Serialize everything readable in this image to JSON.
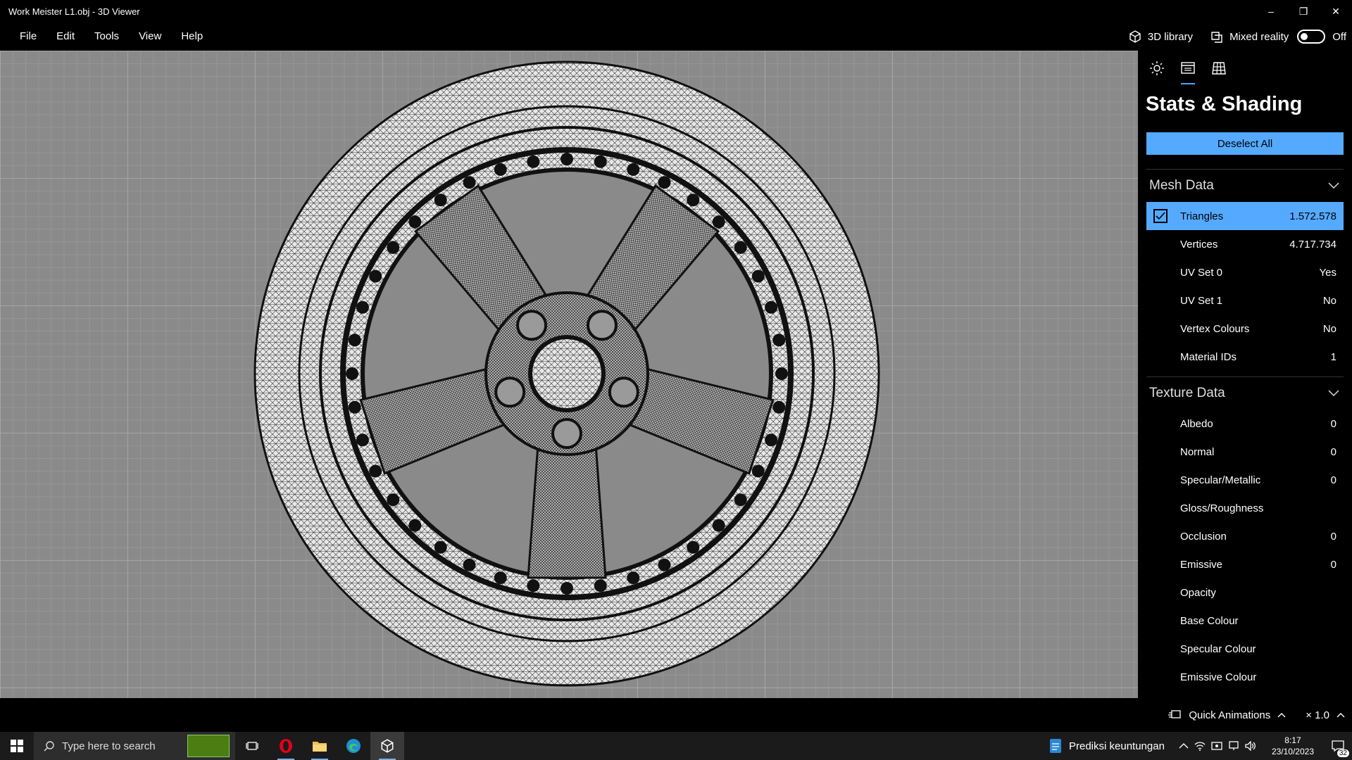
{
  "window": {
    "title": "Work Meister L1.obj - 3D Viewer",
    "minimize": "–",
    "restore": "❐",
    "close": "✕"
  },
  "menu": [
    "File",
    "Edit",
    "Tools",
    "View",
    "Help"
  ],
  "toolbar": {
    "library_label": "3D library",
    "mixed_reality_label": "Mixed reality",
    "mixed_reality_state": "Off"
  },
  "panel": {
    "title": "Stats & Shading",
    "deselect_label": "Deselect All",
    "mesh_section": "Mesh Data",
    "mesh_rows": [
      {
        "label": "Triangles",
        "value": "1.572.578"
      },
      {
        "label": "Vertices",
        "value": "4.717.734"
      },
      {
        "label": "UV Set 0",
        "value": "Yes"
      },
      {
        "label": "UV Set 1",
        "value": "No"
      },
      {
        "label": "Vertex Colours",
        "value": "No"
      },
      {
        "label": "Material IDs",
        "value": "1"
      }
    ],
    "texture_section": "Texture Data",
    "texture_rows": [
      {
        "label": "Albedo",
        "value": "0"
      },
      {
        "label": "Normal",
        "value": "0"
      },
      {
        "label": "Specular/Metallic",
        "value": "0"
      },
      {
        "label": "Gloss/Roughness",
        "value": ""
      },
      {
        "label": "Occlusion",
        "value": "0"
      },
      {
        "label": "Emissive",
        "value": "0"
      },
      {
        "label": "Opacity",
        "value": ""
      },
      {
        "label": "Base Colour",
        "value": ""
      },
      {
        "label": "Specular Colour",
        "value": ""
      },
      {
        "label": "Emissive Colour",
        "value": ""
      }
    ]
  },
  "bottom": {
    "quick_animations": "Quick Animations",
    "speed": "× 1.0"
  },
  "taskbar": {
    "search_placeholder": "Type here to search",
    "weather_text": "Prediksi keuntungan",
    "time": "8:17",
    "date": "23/10/2023",
    "notif_count": "32"
  },
  "colors": {
    "accent": "#55aaff",
    "viewport_bg": "#8a8a8a"
  }
}
